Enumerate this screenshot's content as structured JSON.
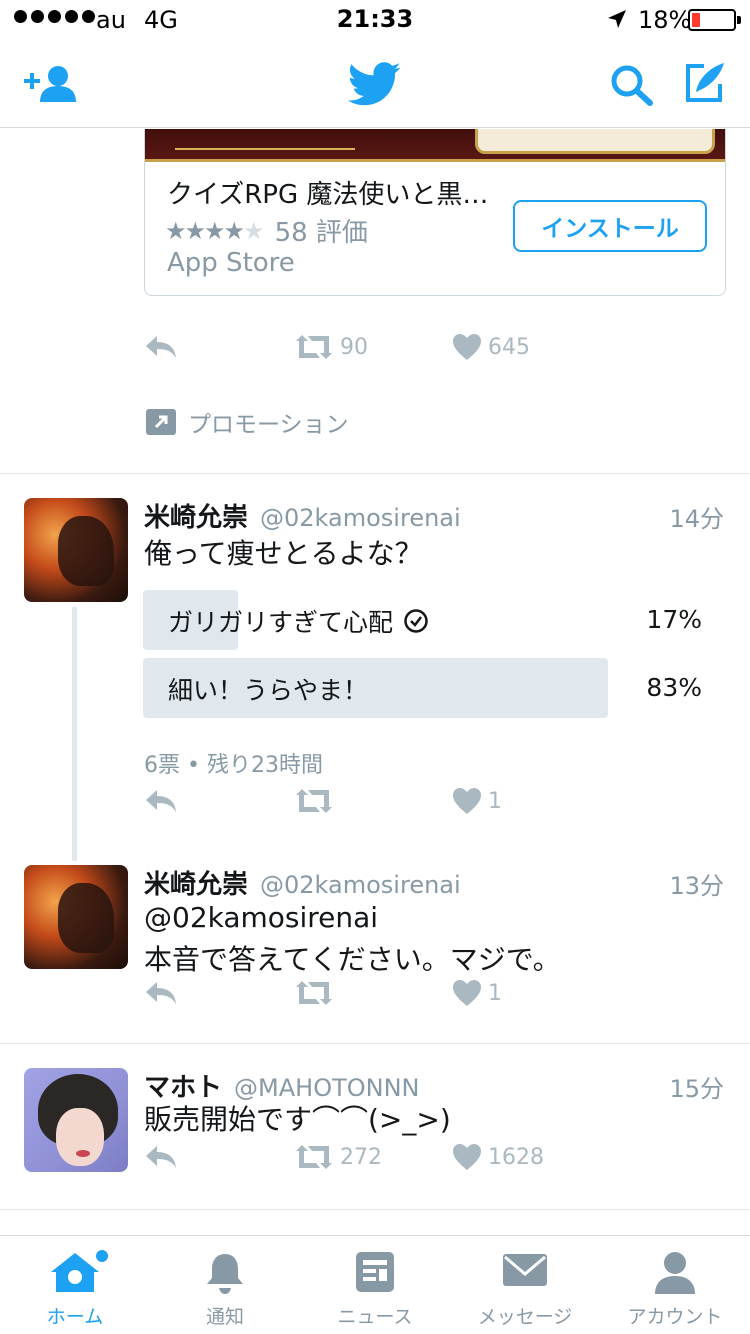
{
  "status_bar": {
    "carrier": "au",
    "network": "4G",
    "time": "21:33",
    "battery_percent": "18%",
    "battery_level": 0.18
  },
  "nav": {
    "icons": [
      "add-user-icon",
      "twitter-bird-icon",
      "search-icon",
      "compose-icon"
    ]
  },
  "promoted": {
    "app_title": "クイズRPG 魔法使いと黒…",
    "rating_count": "58 評価",
    "rating_stars": 3.5,
    "store": "App Store",
    "install_label": "インストール",
    "retweets": "90",
    "likes": "645",
    "promo_label": "プロモーション"
  },
  "tweets": [
    {
      "name": "米崎允崇",
      "handle": "@02kamosirenai",
      "time": "14分",
      "text": "俺って痩せとるよな？",
      "poll": {
        "options": [
          {
            "label": "ガリガリすぎて心配",
            "percent": "17%",
            "share": 0.17,
            "selected": true
          },
          {
            "label": "細い！うらやま！",
            "percent": "83%",
            "share": 0.83,
            "selected": false
          }
        ],
        "meta": "6票 • 残り23時間"
      },
      "retweets": "",
      "likes": "1"
    },
    {
      "name": "米崎允崇",
      "handle": "@02kamosirenai",
      "time": "13分",
      "text_lines": [
        "@02kamosirenai",
        "本音で答えてください。マジで。"
      ],
      "retweets": "",
      "likes": "1"
    },
    {
      "name": "マホト",
      "handle": "@MAHOTONNN",
      "time": "15分",
      "text": "販売開始です⌒⌒(>_>)",
      "retweets": "272",
      "likes": "1628"
    }
  ],
  "tabbar": {
    "tabs": [
      {
        "label": "ホーム",
        "icon": "home-icon",
        "active": true
      },
      {
        "label": "通知",
        "icon": "bell-icon",
        "active": false
      },
      {
        "label": "ニュース",
        "icon": "news-icon",
        "active": false
      },
      {
        "label": "メッセージ",
        "icon": "envelope-icon",
        "active": false
      },
      {
        "label": "アカウント",
        "icon": "person-icon",
        "active": false
      }
    ]
  },
  "colors": {
    "accent": "#1da1f2",
    "muted": "#8899a6",
    "icon_gray": "#aab8c2",
    "poll_bar": "#e1e8ed"
  }
}
